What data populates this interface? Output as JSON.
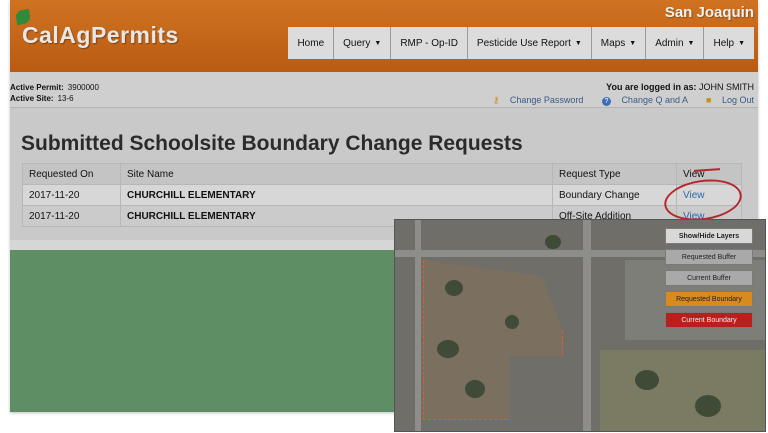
{
  "app": {
    "name": "CalAgPermits",
    "county": "San Joaquin"
  },
  "nav": [
    {
      "label": "Home",
      "caret": ""
    },
    {
      "label": "Query",
      "caret": "▼"
    },
    {
      "label": "RMP - Op-ID",
      "caret": ""
    },
    {
      "label": "Pesticide Use Report",
      "caret": "▼"
    },
    {
      "label": "Maps",
      "caret": "▼"
    },
    {
      "label": "Admin",
      "caret": "▼"
    },
    {
      "label": "Help",
      "caret": "▼"
    }
  ],
  "info": {
    "permit_label": "Active Permit:",
    "permit_value": "3900000",
    "site_label": "Active Site:",
    "site_value": "13-6",
    "logged_in_text": "You are logged in as:",
    "user": "JOHN SMITH",
    "change_password": "Change Password",
    "change_qa": "Change Q and A",
    "logout": "Log Out"
  },
  "page": {
    "title": "Submitted Schoolsite Boundary Change Requests"
  },
  "table": {
    "headers": [
      "Requested On",
      "Site Name",
      "Request Type",
      "View"
    ],
    "rows": [
      {
        "date": "2017-11-20",
        "site": "CHURCHILL ELEMENTARY",
        "type": "Boundary Change",
        "view": "View"
      },
      {
        "date": "2017-11-20",
        "site": "CHURCHILL ELEMENTARY",
        "type": "Off-Site Addition",
        "view": "View"
      }
    ]
  },
  "layers": {
    "title": "Show/Hide Layers",
    "items": [
      "Requested Buffer",
      "Current Buffer",
      "Requested Boundary",
      "Current Boundary"
    ]
  },
  "colors": {
    "header": "#c8691c",
    "boundary": "#e45a21",
    "current_boundary": "#b9201d"
  }
}
